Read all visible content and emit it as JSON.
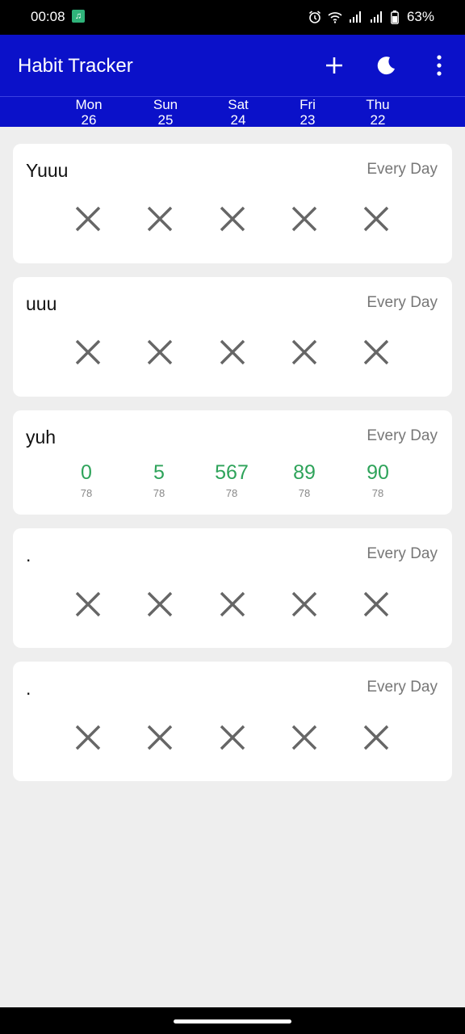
{
  "status_bar": {
    "time": "00:08",
    "battery": "63%",
    "icons": [
      "app-notification-icon",
      "alarm-icon",
      "wifi-icon",
      "signal-icon",
      "signal-icon",
      "battery-icon"
    ]
  },
  "app_bar": {
    "title": "Habit Tracker",
    "actions": [
      "add-icon",
      "dark-mode-icon",
      "more-vert-icon"
    ],
    "background": "#0b11c9"
  },
  "days": [
    {
      "weekday": "Mon",
      "date": "26"
    },
    {
      "weekday": "Sun",
      "date": "25"
    },
    {
      "weekday": "Sat",
      "date": "24"
    },
    {
      "weekday": "Fri",
      "date": "23"
    },
    {
      "weekday": "Thu",
      "date": "22"
    }
  ],
  "habits": [
    {
      "name": "Yuuu",
      "frequency": "Every Day",
      "type": "check",
      "entries": [
        "x",
        "x",
        "x",
        "x",
        "x"
      ]
    },
    {
      "name": "uuu",
      "frequency": "Every Day",
      "type": "check",
      "entries": [
        "x",
        "x",
        "x",
        "x",
        "x"
      ]
    },
    {
      "name": "yuh",
      "frequency": "Every Day",
      "type": "numeric",
      "entries": [
        {
          "value": "0",
          "target": "78"
        },
        {
          "value": "5",
          "target": "78"
        },
        {
          "value": "567",
          "target": "78"
        },
        {
          "value": "89",
          "target": "78"
        },
        {
          "value": "90",
          "target": "78"
        }
      ]
    },
    {
      "name": ".",
      "frequency": "Every Day",
      "type": "check",
      "entries": [
        "x",
        "x",
        "x",
        "x",
        "x"
      ]
    },
    {
      "name": ".",
      "frequency": "Every Day",
      "type": "check",
      "entries": [
        "x",
        "x",
        "x",
        "x",
        "x"
      ]
    }
  ],
  "colors": {
    "accent": "#0b11c9",
    "numeric_value": "#2ea35a",
    "unchecked_mark": "#666666"
  }
}
